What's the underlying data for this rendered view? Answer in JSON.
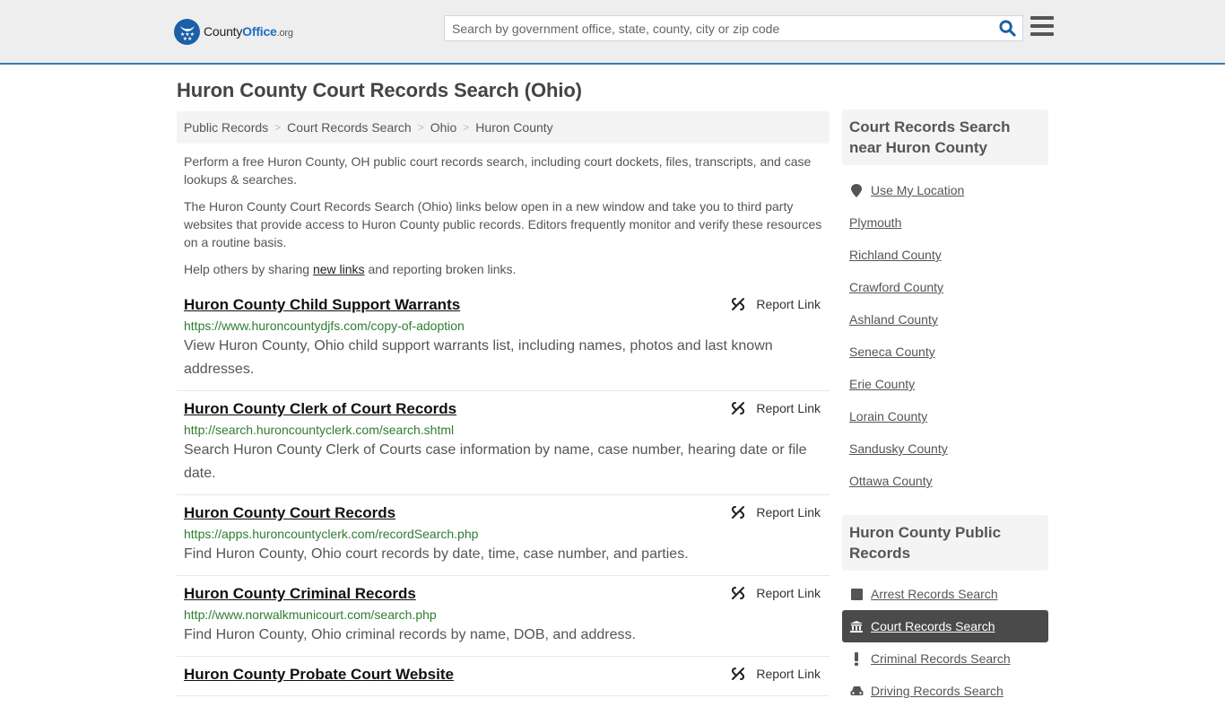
{
  "header": {
    "logo": {
      "county": "County",
      "office": "Office",
      "org": ".org"
    },
    "search_placeholder": "Search by government office, state, county, city or zip code",
    "search_icon": "search-icon",
    "menu_icon": "hamburger-menu-icon",
    "accent_color": "#3a7cb0"
  },
  "page": {
    "title": "Huron County Court Records Search (Ohio)",
    "breadcrumb": [
      "Public Records",
      "Court Records Search",
      "Ohio",
      "Huron County"
    ],
    "intro": {
      "p1": "Perform a free Huron County, OH public court records search, including court dockets, files, transcripts, and case lookups & searches.",
      "p2": "The Huron County Court Records Search (Ohio) links below open in a new window and take you to third party websites that provide access to Huron County public records. Editors frequently monitor and verify these resources on a routine basis.",
      "p3_before": "Help others by sharing ",
      "p3_link": "new links",
      "p3_after": " and reporting broken links."
    },
    "report_label": "Report Link",
    "results": [
      {
        "title": "Huron County Child Support Warrants",
        "url": "https://www.huroncountydjfs.com/copy-of-adoption",
        "desc": "View Huron County, Ohio child support warrants list, including names, photos and last known addresses."
      },
      {
        "title": "Huron County Clerk of Court Records",
        "url": "http://search.huroncountyclerk.com/search.shtml",
        "desc": "Search Huron County Clerk of Courts case information by name, case number, hearing date or file date."
      },
      {
        "title": "Huron County Court Records",
        "url": "https://apps.huroncountyclerk.com/recordSearch.php",
        "desc": "Find Huron County, Ohio court records by date, time, case number, and parties."
      },
      {
        "title": "Huron County Criminal Records",
        "url": "http://www.norwalkmunicourt.com/search.php",
        "desc": "Find Huron County, Ohio criminal records by name, DOB, and address."
      },
      {
        "title": "Huron County Probate Court Website",
        "url": "",
        "desc": ""
      }
    ]
  },
  "sidebar": {
    "near_heading": "Court Records Search near Huron County",
    "use_location": "Use My Location",
    "near_items": [
      "Plymouth",
      "Richland County",
      "Crawford County",
      "Ashland County",
      "Seneca County",
      "Erie County",
      "Lorain County",
      "Sandusky County",
      "Ottawa County"
    ],
    "records_heading": "Huron County Public Records",
    "records_items": [
      {
        "label": "Arrest Records Search",
        "icon": "square-icon",
        "active": false
      },
      {
        "label": "Court Records Search",
        "icon": "courthouse-icon",
        "active": true
      },
      {
        "label": "Criminal Records Search",
        "icon": "exclamation-icon",
        "active": false
      },
      {
        "label": "Driving Records Search",
        "icon": "car-icon",
        "active": false
      }
    ]
  }
}
